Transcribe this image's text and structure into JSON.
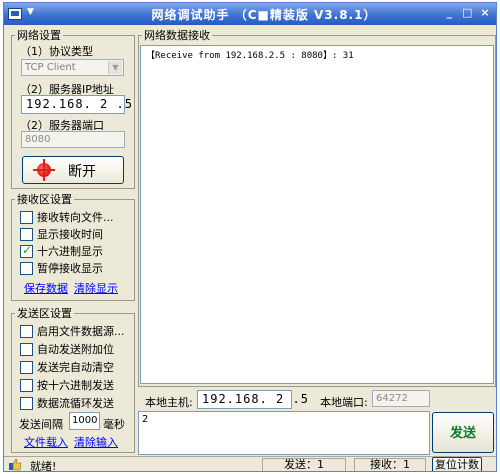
{
  "title_bar": {
    "title": "网络调试助手 （C■精装版 V3.8.1）",
    "min": "_",
    "max": "□",
    "close": "×"
  },
  "network_settings": {
    "legend": "网络设置",
    "protocol_label": "（1）协议类型",
    "protocol_value": "TCP Client",
    "server_ip_label": "（2）服务器IP地址",
    "server_ip": "192.168. 2 .5",
    "server_port_label": "（2）服务器端口",
    "server_port": "8080",
    "connect_button": "断开"
  },
  "receive_settings": {
    "legend": "接收区设置",
    "options": [
      {
        "label": "接收转向文件...",
        "checked": false
      },
      {
        "label": "显示接收时间",
        "checked": false
      },
      {
        "label": "十六进制显示",
        "checked": true
      },
      {
        "label": "暂停接收显示",
        "checked": false
      }
    ],
    "save_link": "保存数据",
    "clear_link": "清除显示"
  },
  "send_settings": {
    "legend": "发送区设置",
    "options": [
      {
        "label": "启用文件数据源...",
        "checked": false
      },
      {
        "label": "自动发送附加位",
        "checked": false
      },
      {
        "label": "发送完自动清空",
        "checked": false
      },
      {
        "label": "按十六进制发送",
        "checked": false
      },
      {
        "label": "数据流循环发送",
        "checked": false
      }
    ],
    "interval_label": "发送间隔",
    "interval_value": "1000",
    "interval_unit": "毫秒",
    "file_load_link": "文件载入",
    "clear_input_link": "清除输入"
  },
  "receive_area": {
    "legend": "网络数据接收",
    "content": "【Receive from 192.168.2.5 : 8080】: 31"
  },
  "local_info": {
    "host_label": "本地主机:",
    "host_ip": "192.168. 2 .5",
    "port_label": "本地端口:",
    "port_value": "64272"
  },
  "send_area": {
    "content": "2",
    "send_button": "发送"
  },
  "status_bar": {
    "status": "就绪!",
    "sent": "发送：1",
    "received": "接收：1",
    "reset_button": "复位计数"
  }
}
